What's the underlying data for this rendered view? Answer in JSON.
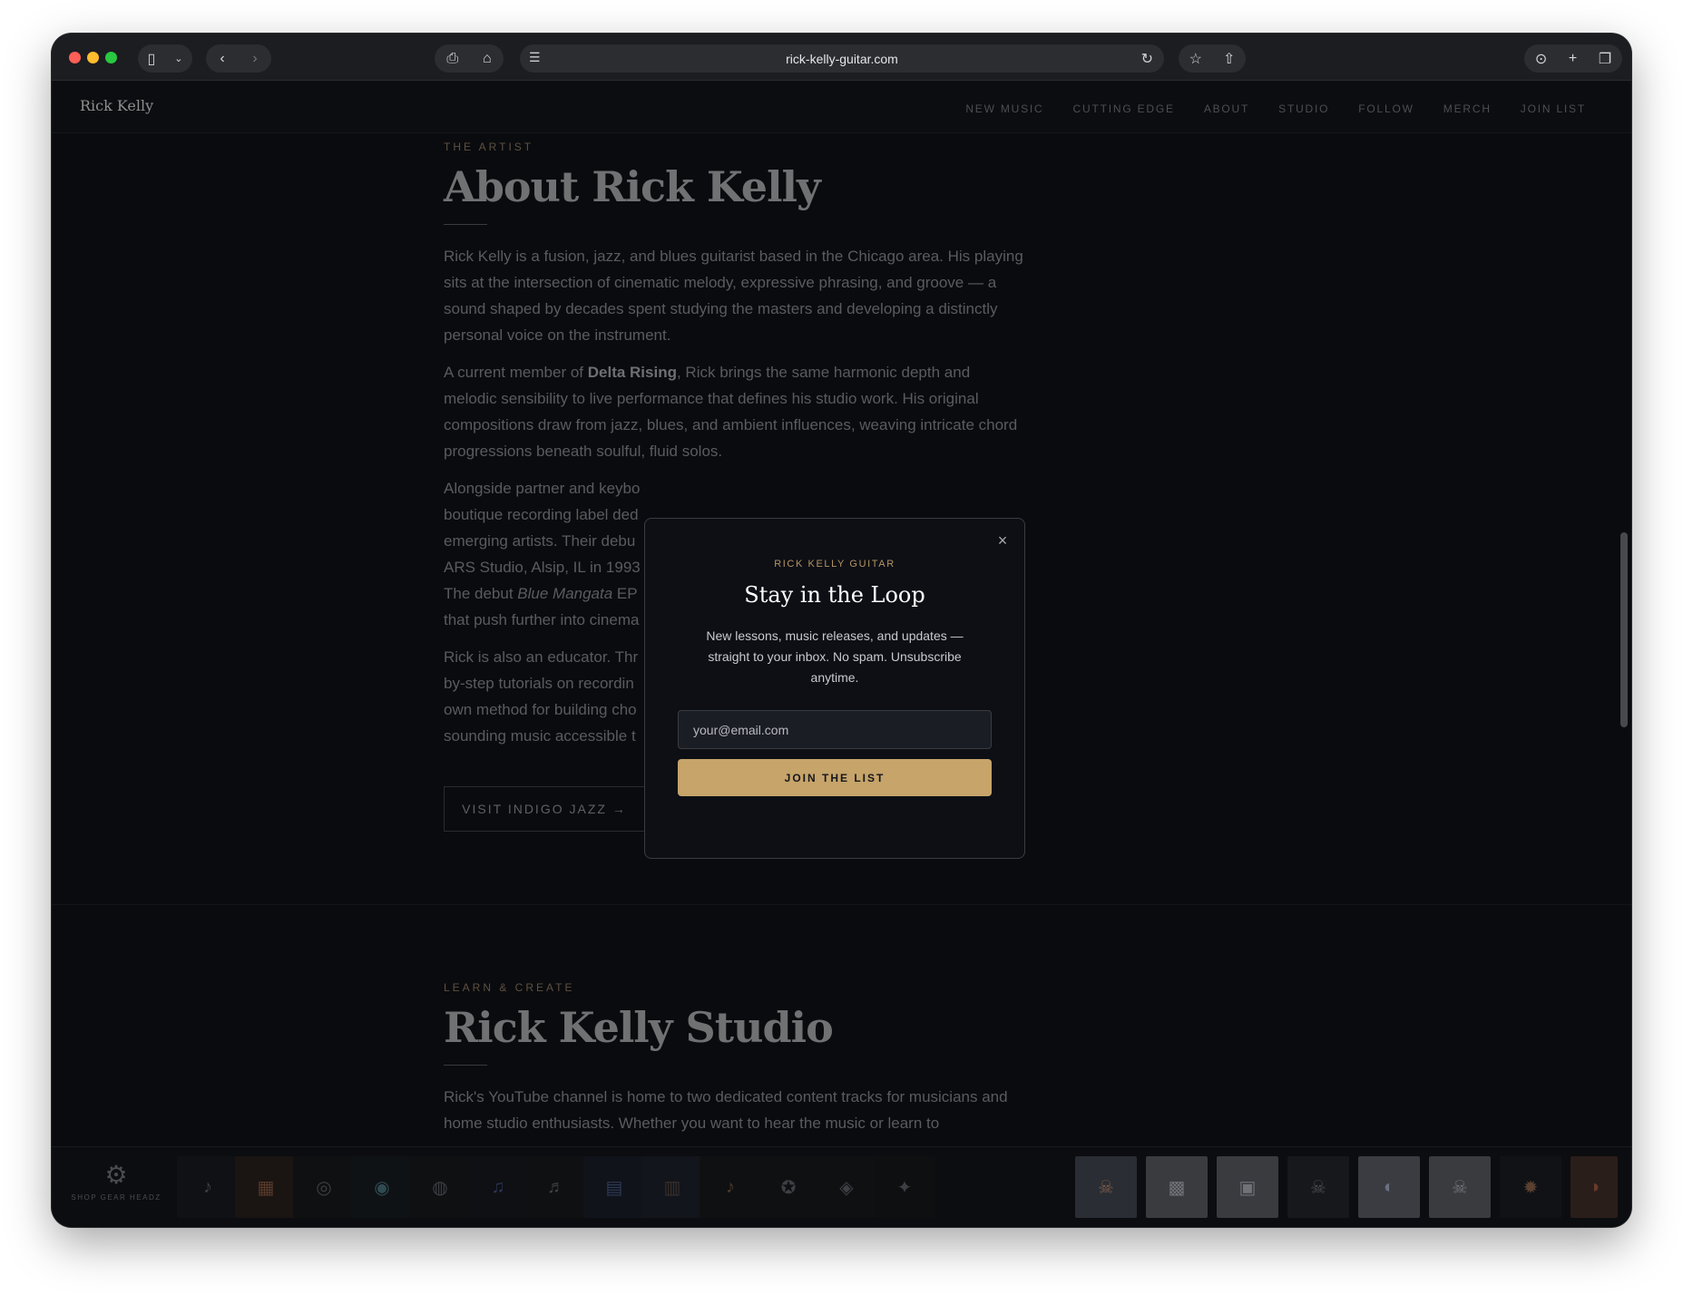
{
  "browser": {
    "url": "rick-kelly-guitar.com"
  },
  "site": {
    "logo": "Rick Kelly",
    "nav": [
      "NEW MUSIC",
      "CUTTING EDGE",
      "ABOUT",
      "STUDIO",
      "FOLLOW",
      "MERCH",
      "JOIN LIST"
    ]
  },
  "about": {
    "eyebrow": "THE ARTIST",
    "title": "About Rick Kelly",
    "p1": "Rick Kelly is a fusion, jazz, and blues guitarist based in the Chicago area. His playing sits at the intersection of cinematic melody, expressive phrasing, and groove — a sound shaped by decades spent studying the masters and developing a distinctly personal voice on the instrument.",
    "p2_before": "A current member of ",
    "p2_band": "Delta Rising",
    "p2_after": ", Rick brings the same harmonic depth and melodic sensibility to live performance that defines his studio work. His original compositions draw from jazz, blues, and ambient influences, weaving intricate chord progressions beneath soulful, fluid solos.",
    "p3_lines": [
      "Alongside partner and keybo",
      "boutique recording label ded",
      "emerging artists. Their debu",
      "ARS Studio, Alsip, IL in 1993",
      "The debut ",
      "that push further into cinema"
    ],
    "p3_album": "Blue Mangata",
    "p3_line5_after": " EP",
    "p4_lines": [
      "Rick is also an educator. Thr",
      "by-step tutorials on recordin",
      "own method for building cho",
      "sounding music accessible t"
    ],
    "button": "VISIT INDIGO JAZZ →"
  },
  "studio": {
    "eyebrow": "LEARN & CREATE",
    "title": "Rick Kelly Studio",
    "p1": "Rick's YouTube channel is home to two dedicated content tracks for musicians and home studio enthusiasts. Whether you want to hear the music or learn to"
  },
  "footer": {
    "shop_label": "SHOP GEAR HEADZ"
  },
  "modal": {
    "kicker": "RICK KELLY GUITAR",
    "title": "Stay in the Loop",
    "desc": "New lessons, music releases, and updates — straight to your inbox. No spam. Unsubscribe anytime.",
    "placeholder": "your@email.com",
    "button": "JOIN THE LIST",
    "close": "×"
  },
  "colors": {
    "accent": "#c6a46a",
    "background": "#0a0b0e"
  }
}
